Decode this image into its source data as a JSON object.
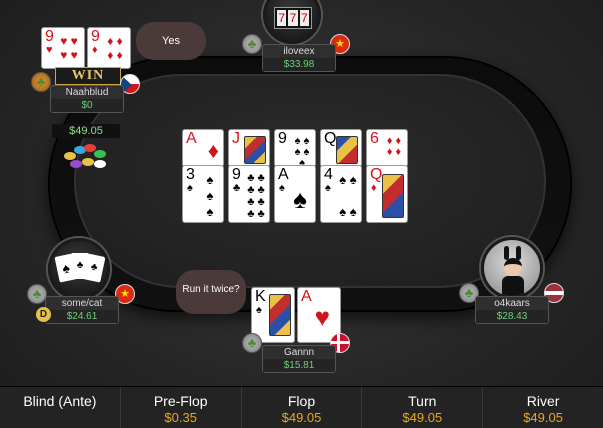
{
  "players": {
    "top_left": {
      "name": "Naahblud",
      "stack": "$0",
      "badge": "WIN",
      "cards": [
        {
          "rank": "9",
          "suit": "♥"
        },
        {
          "rank": "9",
          "suit": "♦"
        }
      ],
      "chat": "Yes"
    },
    "top": {
      "name": "iloveex",
      "stack": "$33.98"
    },
    "left": {
      "name": "some/cat",
      "stack": "$24.61",
      "dealer": "D"
    },
    "right": {
      "name": "o4kaars",
      "stack": "$28.43"
    },
    "bottom": {
      "name": "Gannn",
      "stack": "$15.81",
      "cards": [
        {
          "rank": "K",
          "suit": "♠"
        },
        {
          "rank": "A",
          "suit": "♥"
        }
      ],
      "chat": "Run it twice?"
    }
  },
  "pot_amount": "$49.05",
  "board": {
    "run1": [
      {
        "rank": "A",
        "suit": "♦"
      },
      {
        "rank": "J",
        "suit": "♦"
      },
      {
        "rank": "9",
        "suit": "♠"
      },
      {
        "rank": "Q",
        "suit": "♠"
      },
      {
        "rank": "6",
        "suit": "♦"
      }
    ],
    "run2": [
      {
        "rank": "3",
        "suit": "♠"
      },
      {
        "rank": "9",
        "suit": "♣"
      },
      {
        "rank": "A",
        "suit": "♠"
      },
      {
        "rank": "4",
        "suit": "♠"
      },
      {
        "rank": "Q",
        "suit": "♦"
      }
    ]
  },
  "stages": [
    {
      "label": "Blind (Ante)",
      "value": ""
    },
    {
      "label": "Pre-Flop",
      "value": "$0.35"
    },
    {
      "label": "Flop",
      "value": "$49.05"
    },
    {
      "label": "Turn",
      "value": "$49.05"
    },
    {
      "label": "River",
      "value": "$49.05"
    }
  ],
  "icons": {
    "clover": "clover-icon",
    "flags": {
      "top": "china-flag",
      "left": "china-flag",
      "bottom": "denmark-flag",
      "right": "latvia-flag",
      "top_left": "czech-flag"
    }
  },
  "colors": {
    "stack": "#6cd17a",
    "stage_value": "#e8a824",
    "red_suit": "#d0141c"
  }
}
